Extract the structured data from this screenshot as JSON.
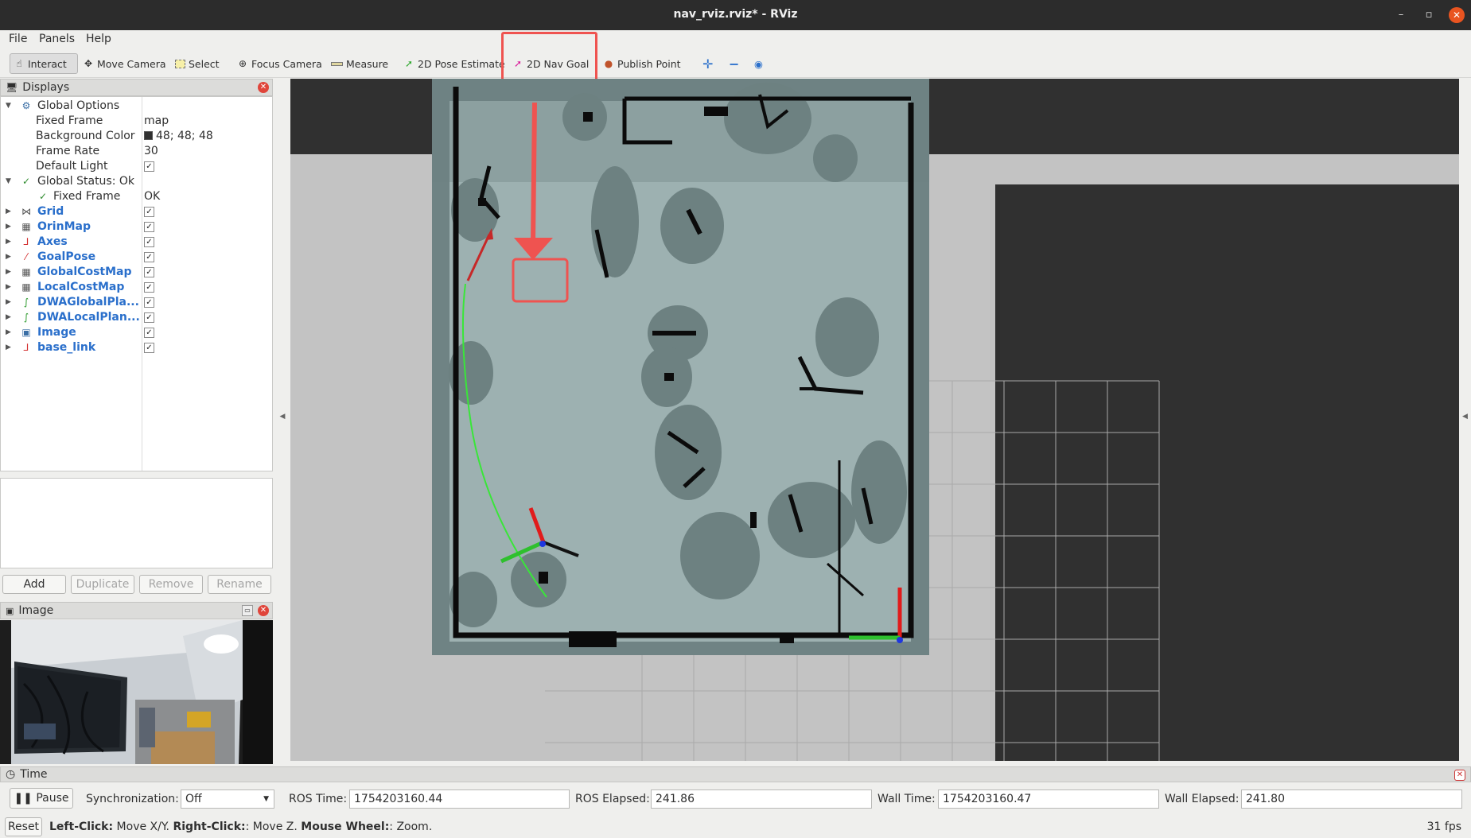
{
  "window": {
    "title": "nav_rviz.rviz* - RViz"
  },
  "menu": {
    "file": "File",
    "panels": "Panels",
    "help": "Help"
  },
  "toolbar": {
    "interact": "Interact",
    "move_camera": "Move Camera",
    "select": "Select",
    "focus_camera": "Focus Camera",
    "measure": "Measure",
    "pose_estimate": "2D Pose Estimate",
    "nav_goal": "2D Nav Goal",
    "publish_point": "Publish Point"
  },
  "displays": {
    "title": "Displays",
    "global_options": "Global Options",
    "fixed_frame_label": "Fixed Frame",
    "fixed_frame_value": "map",
    "background_color_label": "Background Color",
    "background_color_value": "48; 48; 48",
    "frame_rate_label": "Frame Rate",
    "frame_rate_value": "30",
    "default_light_label": "Default Light",
    "global_status": "Global Status: Ok",
    "status_fixed_frame": "Fixed Frame",
    "status_fixed_frame_value": "OK",
    "items": [
      {
        "label": "Grid",
        "icon": "grid-icon",
        "color": "#555555"
      },
      {
        "label": "OrinMap",
        "icon": "map-icon",
        "color": "#555555"
      },
      {
        "label": "Axes",
        "icon": "axes-icon",
        "color": "#d32f2f"
      },
      {
        "label": "GoalPose",
        "icon": "arrow-icon",
        "color": "#d32f2f"
      },
      {
        "label": "GlobalCostMap",
        "icon": "map-icon",
        "color": "#555555"
      },
      {
        "label": "LocalCostMap",
        "icon": "map-icon",
        "color": "#555555"
      },
      {
        "label": "DWAGlobalPla...",
        "icon": "path-icon",
        "color": "#2e9b2e"
      },
      {
        "label": "DWALocalPlan...",
        "icon": "path-icon",
        "color": "#2e9b2e"
      },
      {
        "label": "Image",
        "icon": "image-icon",
        "color": "#3a6ea5"
      },
      {
        "label": "base_link",
        "icon": "axes-icon",
        "color": "#d32f2f"
      }
    ],
    "buttons": {
      "add": "Add",
      "duplicate": "Duplicate",
      "remove": "Remove",
      "rename": "Rename"
    }
  },
  "image_panel": {
    "title": "Image"
  },
  "time_panel": {
    "title": "Time",
    "pause": "Pause",
    "sync_label": "Synchronization:",
    "sync_value": "Off",
    "ros_time_label": "ROS Time:",
    "ros_time": "1754203160.44",
    "ros_elapsed_label": "ROS Elapsed:",
    "ros_elapsed": "241.86",
    "wall_time_label": "Wall Time:",
    "wall_time": "1754203160.47",
    "wall_elapsed_label": "Wall Elapsed:",
    "wall_elapsed": "241.80"
  },
  "status": {
    "reset": "Reset",
    "left_click": "Left-Click:",
    "left_click_desc": " Move X/Y. ",
    "right_click": "Right-Click:",
    "right_click_desc": ": Move Z. ",
    "wheel": "Mouse Wheel:",
    "wheel_desc": ": Zoom.",
    "fps": "31 fps"
  },
  "colors": {
    "highlight": "#ef5350",
    "background": "#303030",
    "path": "#39e639"
  }
}
